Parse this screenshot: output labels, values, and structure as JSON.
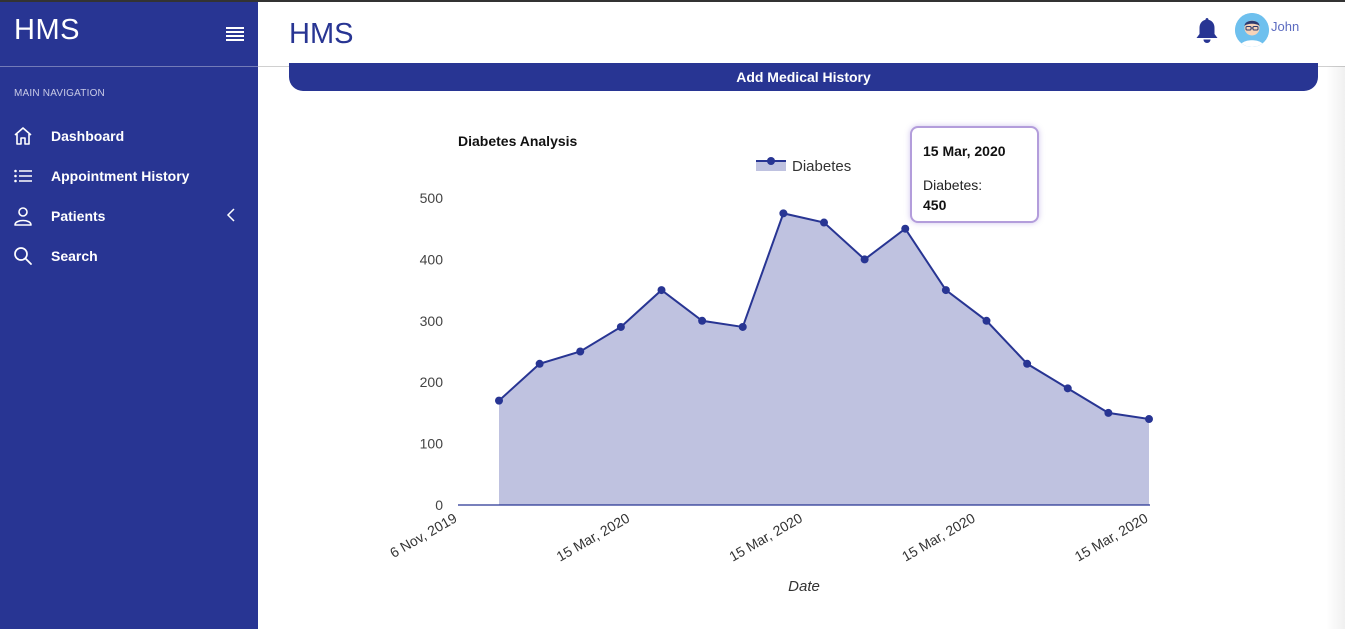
{
  "sidebar": {
    "brand": "HMS",
    "nav_header": "MAIN NAVIGATION",
    "items": [
      {
        "label": "Dashboard",
        "icon": "home-icon"
      },
      {
        "label": "Appointment History",
        "icon": "list-icon"
      },
      {
        "label": "Patients",
        "icon": "user-icon"
      },
      {
        "label": "Search",
        "icon": "search-icon"
      }
    ]
  },
  "header": {
    "title": "HMS",
    "user_name": "John"
  },
  "main": {
    "add_button_label": "Add Medical History"
  },
  "colors": {
    "primary": "#283593",
    "area_fill": "#bfc2e0",
    "tooltip_border": "#b39ddb"
  },
  "tooltip": {
    "date": "15 Mar, 2020",
    "series": "Diabetes:",
    "value": "450"
  },
  "chart_data": {
    "type": "area",
    "title": "Diabetes Analysis",
    "xlabel": "Date",
    "ylabel": "",
    "ylim": [
      0,
      500
    ],
    "yticks": [
      0,
      100,
      200,
      300,
      400,
      500
    ],
    "x_tick_labels": [
      "6 Nov, 2019",
      "15 Mar, 2020",
      "15 Mar, 2020",
      "15 Mar, 2020",
      "15 Mar, 2020"
    ],
    "legend_position": "top",
    "series": [
      {
        "name": "Diabetes",
        "values": [
          170,
          230,
          250,
          290,
          350,
          300,
          290,
          475,
          460,
          400,
          450,
          350,
          300,
          230,
          190,
          150,
          140
        ]
      }
    ]
  }
}
